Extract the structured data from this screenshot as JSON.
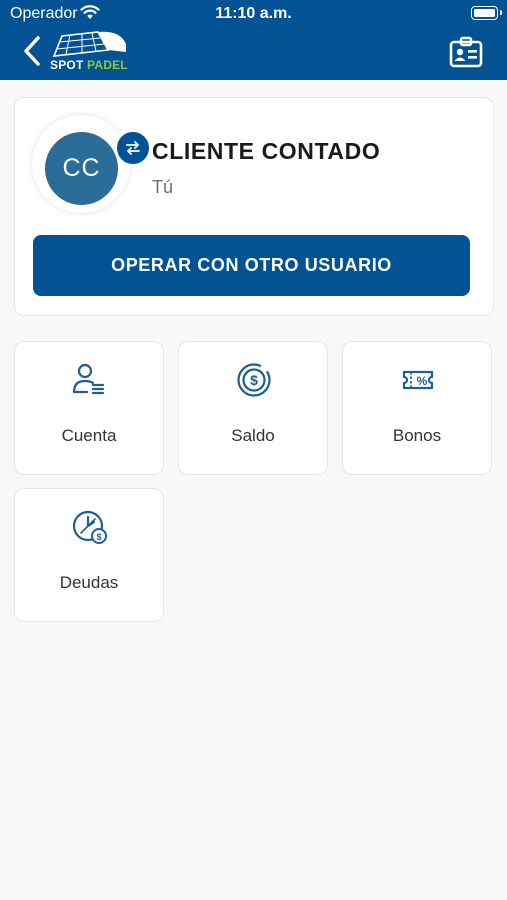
{
  "status_bar": {
    "carrier": "Operador",
    "time": "11:10 a.m."
  },
  "header": {
    "logo_text_1": "SPOT",
    "logo_text_2": "PADEL",
    "back_icon": "chevron-left-icon",
    "right_icon": "id-card-icon"
  },
  "profile": {
    "initials": "CC",
    "name": "CLIENTE CONTADO",
    "subtitle": "Tú",
    "swap_icon": "swap-arrows-icon",
    "operate_button": "OPERAR CON OTRO USUARIO"
  },
  "menu": [
    {
      "label": "Cuenta",
      "icon": "user-list-icon"
    },
    {
      "label": "Saldo",
      "icon": "dollar-coin-icon"
    },
    {
      "label": "Bonos",
      "icon": "discount-ticket-icon"
    },
    {
      "label": "Deudas",
      "icon": "clock-dollar-icon"
    }
  ],
  "colors": {
    "primary": "#035293",
    "avatar": "#2a6d98",
    "brand_green": "#8dc63f",
    "icon_blue": "#1d5f8f"
  }
}
